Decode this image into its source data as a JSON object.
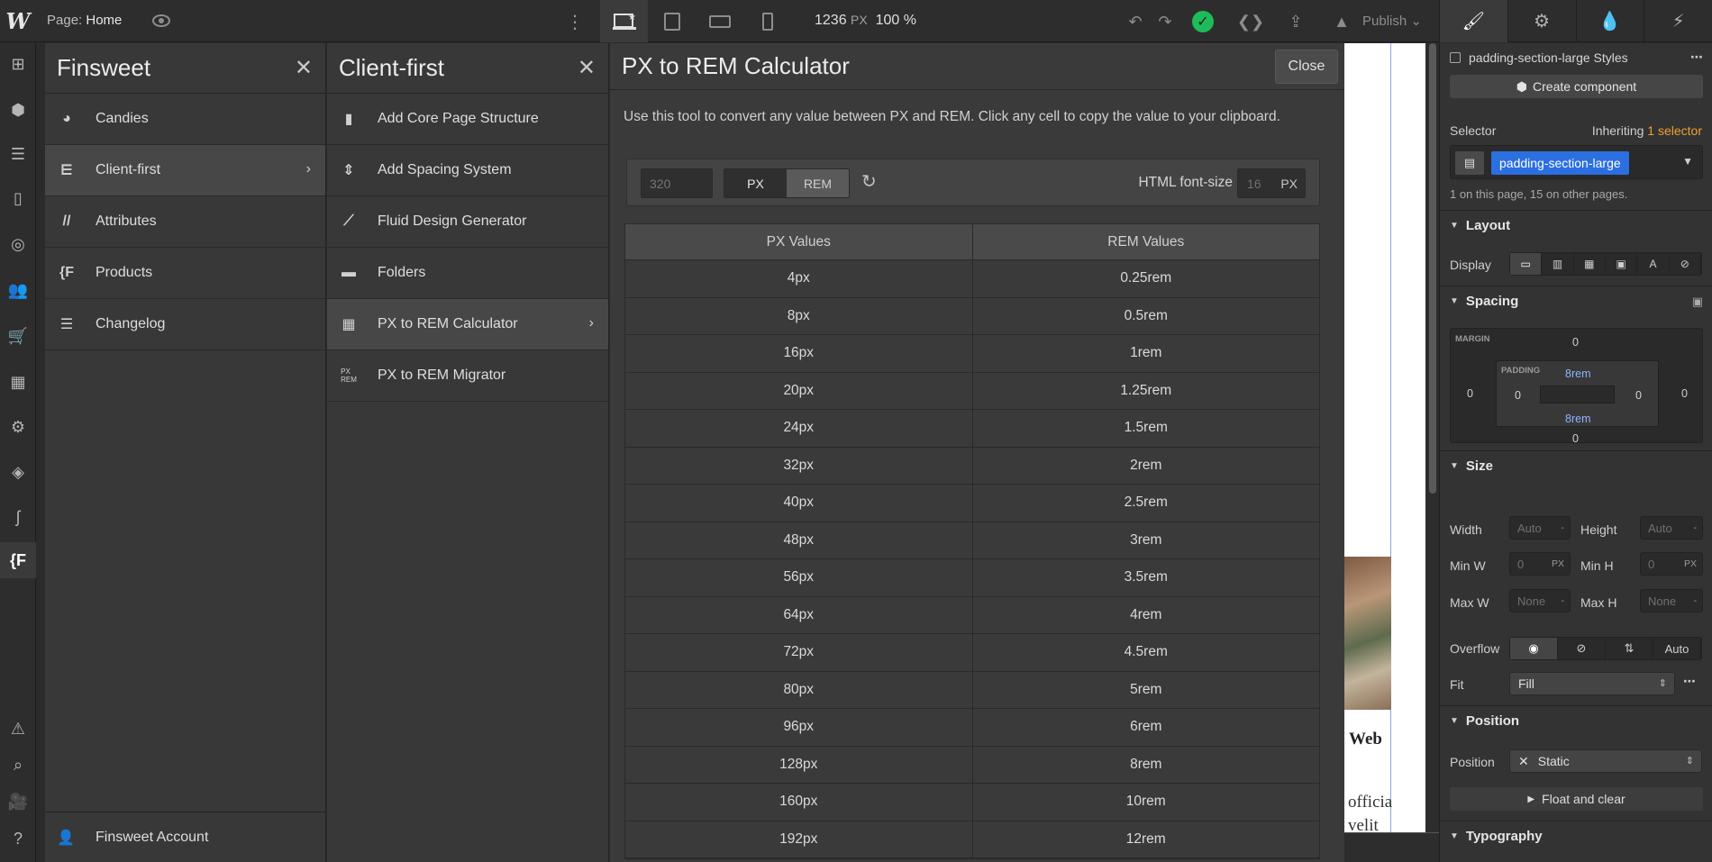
{
  "topbar": {
    "logo": "W",
    "page_label": "Page:",
    "page_name": "Home",
    "width_value": "1236",
    "width_unit": "PX",
    "zoom": "100 %",
    "publish_label": "Publish"
  },
  "finsweet": {
    "title": "Finsweet",
    "items": [
      {
        "label": "Candies",
        "icon": "candy-icon"
      },
      {
        "label": "Client-first",
        "icon": "client-first-icon"
      },
      {
        "label": "Attributes",
        "icon": "attributes-icon"
      },
      {
        "label": "Products",
        "icon": "products-icon"
      },
      {
        "label": "Changelog",
        "icon": "changelog-icon"
      }
    ],
    "account": "Finsweet Account"
  },
  "clientfirst": {
    "title": "Client-first",
    "items": [
      {
        "label": "Add Core Page Structure",
        "icon": "document-icon"
      },
      {
        "label": "Add Spacing System",
        "icon": "spacing-icon"
      },
      {
        "label": "Fluid Design Generator",
        "icon": "chart-line-icon"
      },
      {
        "label": "Folders",
        "icon": "folder-icon"
      },
      {
        "label": "PX to REM Calculator",
        "icon": "calculator-icon"
      },
      {
        "label": "PX to REM Migrator",
        "icon": "px-rem-icon"
      }
    ]
  },
  "calculator": {
    "title": "PX to REM Calculator",
    "close_label": "Close",
    "description": "Use this tool to convert any value between PX and REM. Click any cell to copy the value to your clipboard.",
    "input_placeholder": "320",
    "toggle_px": "PX",
    "toggle_rem": "REM",
    "font_size_label": "HTML font-size",
    "font_size_value": "16",
    "font_size_unit": "PX",
    "col_px": "PX Values",
    "col_rem": "REM Values",
    "rows": [
      [
        "4px",
        "0.25rem"
      ],
      [
        "8px",
        "0.5rem"
      ],
      [
        "16px",
        "1rem"
      ],
      [
        "20px",
        "1.25rem"
      ],
      [
        "24px",
        "1.5rem"
      ],
      [
        "32px",
        "2rem"
      ],
      [
        "40px",
        "2.5rem"
      ],
      [
        "48px",
        "3rem"
      ],
      [
        "56px",
        "3.5rem"
      ],
      [
        "64px",
        "4rem"
      ],
      [
        "72px",
        "4.5rem"
      ],
      [
        "80px",
        "5rem"
      ],
      [
        "96px",
        "6rem"
      ],
      [
        "128px",
        "8rem"
      ],
      [
        "160px",
        "10rem"
      ],
      [
        "192px",
        "12rem"
      ]
    ]
  },
  "canvas": {
    "heading_fragment": "Web",
    "text_line1": "officia",
    "text_line2": "velit"
  },
  "styles": {
    "style_name": "padding-section-large Styles",
    "create_component": "Create component",
    "selector_label": "Selector",
    "inheriting_text": "Inheriting",
    "inheriting_link": "1 selector",
    "selector_tag": "padding-section-large",
    "usage": "1 on this page, 15 on other pages.",
    "layout_title": "Layout",
    "display_label": "Display",
    "spacing_title": "Spacing",
    "margin_label": "MARGIN",
    "padding_label": "PADDING",
    "margin_top": "0",
    "margin_bottom": "0",
    "margin_left": "0",
    "margin_right": "0",
    "padding_top": "8rem",
    "padding_bottom": "8rem",
    "padding_left": "0",
    "padding_right": "0",
    "size_title": "Size",
    "width_label": "Width",
    "height_label": "Height",
    "width_val": "Auto",
    "height_val": "Auto",
    "min_w_label": "Min W",
    "min_h_label": "Min H",
    "min_w_val": "0",
    "min_h_val": "0",
    "min_unit": "PX",
    "max_w_label": "Max W",
    "max_h_label": "Max H",
    "max_w_val": "None",
    "max_h_val": "None",
    "dash": "-",
    "overflow_label": "Overflow",
    "overflow_auto": "Auto",
    "fit_label": "Fit",
    "fit_val": "Fill",
    "position_title": "Position",
    "position_label": "Position",
    "position_val": "Static",
    "float_clear": "Float and clear",
    "typography_title": "Typography"
  },
  "colors": {
    "accent_blue": "#2b6fe0",
    "success_green": "#1dbb5a",
    "inherit_orange": "#f0a030"
  }
}
